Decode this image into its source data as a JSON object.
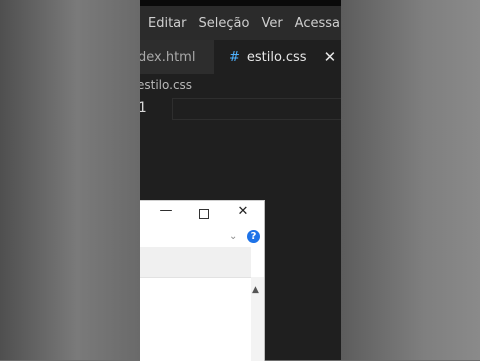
{
  "menubar": {
    "items": [
      "Editar",
      "Seleção",
      "Ver",
      "Acessar"
    ]
  },
  "tabs": [
    {
      "label": "dex.html",
      "active": false
    },
    {
      "label": "estilo.css",
      "active": true,
      "icon": "#"
    }
  ],
  "breadcrumb": "estilo.css",
  "editor": {
    "line_numbers": [
      "1"
    ]
  },
  "dialog": {
    "minimize": "—",
    "close": "✕",
    "chevron": "⌄",
    "help": "?",
    "scroll_up": "▲"
  },
  "colors": {
    "editor_bg": "#1f1f1f",
    "css_icon": "#4fb2ff",
    "help_icon": "#1e73e8"
  }
}
